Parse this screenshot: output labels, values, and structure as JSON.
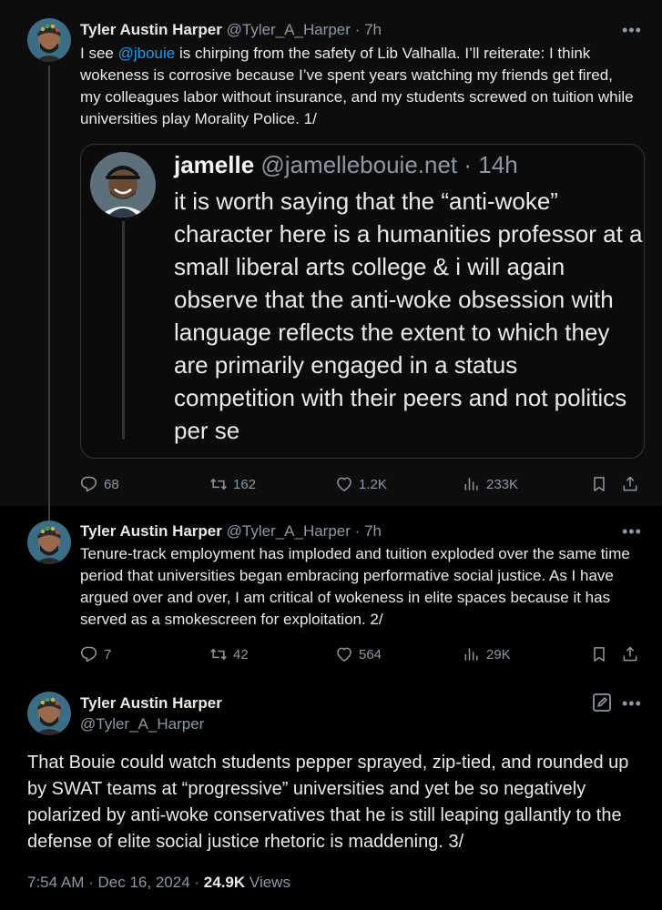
{
  "tweets": [
    {
      "author_name": "Tyler Austin Harper",
      "author_handle": "@Tyler_A_Harper",
      "separator": "·",
      "time": "7h",
      "text_before_mention": "I see ",
      "mention": "@jbouie",
      "text_after_mention": " is chirping from the safety of Lib Valhalla. I’ll reiterate: I think wokeness is corrosive because I’ve spent years watching my friends get fired, my colleagues labor without insurance, and my students screwed on tuition while universities play Morality Police. 1/",
      "replies": "68",
      "reposts": "162",
      "likes": "1.2K",
      "views": "233K"
    },
    {
      "author_name": "Tyler Austin Harper",
      "author_handle": "@Tyler_A_Harper",
      "separator": "·",
      "time": "7h",
      "text": "Tenure-track employment has imploded and tuition exploded over the same time period that universities began embracing performative social justice. As I have argued over and over, I am critical of wokeness in elite spaces because it has served as a smokescreen for exploitation. 2/",
      "replies": "7",
      "reposts": "42",
      "likes": "564",
      "views": "29K"
    },
    {
      "author_name": "Tyler Austin Harper",
      "author_handle": "@Tyler_A_Harper",
      "text": "That Bouie could watch students pepper sprayed, zip-tied, and rounded up by SWAT teams at “progressive” universities and yet be so negatively polarized by anti-woke conservatives that he is still leaping gallantly to the defense of elite social justice rhetoric is maddening. 3/",
      "time": "7:54 AM",
      "date": "Dec 16, 2024",
      "separator": "·",
      "views_count": "24.9K",
      "views_label": "Views"
    }
  ],
  "quote": {
    "author_name": "jamelle",
    "author_handle": "@jamellebouie.net",
    "separator": "·",
    "time": "14h",
    "text": "it is worth saying that the “anti-woke” character here is a humanities professor at a small liberal arts college & i will again observe that the anti-woke obsession with language reflects the extent to which they are primarily engaged in a status competition with their peers and not politics per se"
  },
  "icons": {
    "more": "more-icon",
    "reply": "reply-icon",
    "repost": "repost-icon",
    "like": "heart-icon",
    "views": "views-icon",
    "bookmark": "bookmark-icon",
    "share": "share-icon",
    "edit": "edit-icon"
  },
  "colors": {
    "background": "#000000",
    "text": "#e7e9ea",
    "secondary": "#8b98a5",
    "mention": "#1d9bf0",
    "border": "#333639"
  }
}
